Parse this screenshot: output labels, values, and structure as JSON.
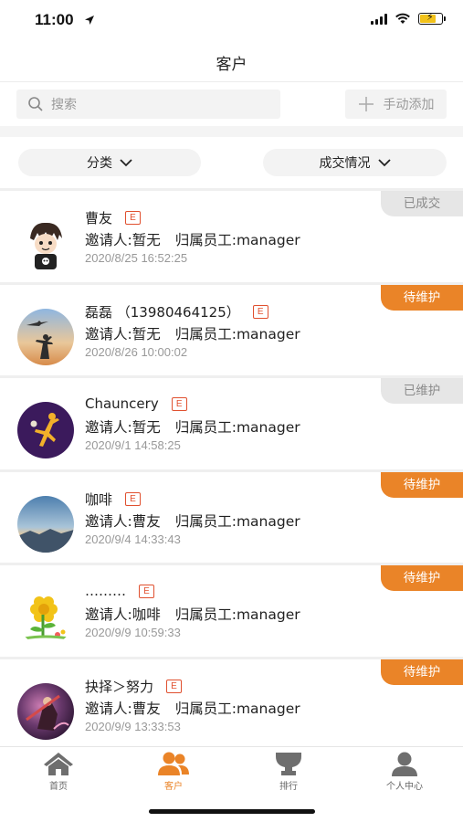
{
  "status_bar": {
    "time": "11:00"
  },
  "nav": {
    "title": "客户"
  },
  "search": {
    "placeholder": "搜索",
    "add_label": "手动添加"
  },
  "filters": {
    "category_label": "分类",
    "deal_label": "成交情况"
  },
  "customers": [
    {
      "name": "曹友",
      "badge": "E",
      "inviter": "邀请人:暂无",
      "staff": "归属员工:manager",
      "time": "2020/8/25 16:52:25",
      "status": "已成交",
      "status_kind": "gray",
      "avatar": "cartoon-boy"
    },
    {
      "name": "磊磊 （13980464125）",
      "badge": "E",
      "inviter": "邀请人:暂无",
      "staff": "归属员工:manager",
      "time": "2020/8/26 10:00:02",
      "status": "待维护",
      "status_kind": "orange",
      "avatar": "sunset-sky"
    },
    {
      "name": "Chauncery",
      "badge": "E",
      "inviter": "邀请人:暂无",
      "staff": "归属员工:manager",
      "time": "2020/9/1 14:58:25",
      "status": "已维护",
      "status_kind": "gray",
      "avatar": "purple-figure"
    },
    {
      "name": "咖啡",
      "badge": "E",
      "inviter": "邀请人:曹友",
      "staff": "归属员工:manager",
      "time": "2020/9/4 14:33:43",
      "status": "待维护",
      "status_kind": "orange",
      "avatar": "blue-landscape"
    },
    {
      "name": "………",
      "badge": "E",
      "inviter": "邀请人:咖啡",
      "staff": "归属员工:manager",
      "time": "2020/9/9 10:59:33",
      "status": "待维护",
      "status_kind": "orange",
      "avatar": "flower"
    },
    {
      "name": "抉择＞努力",
      "badge": "E",
      "inviter": "邀请人:曹友",
      "staff": "归属员工:manager",
      "time": "2020/9/9 13:33:53",
      "status": "待维护",
      "status_kind": "orange",
      "avatar": "warrior-art"
    }
  ],
  "tabs": [
    {
      "label": "首页",
      "icon": "home-icon"
    },
    {
      "label": "客户",
      "icon": "customers-icon",
      "active": true
    },
    {
      "label": "排行",
      "icon": "ranking-icon"
    },
    {
      "label": "个人中心",
      "icon": "profile-icon"
    }
  ],
  "colors": {
    "accent": "#ea8428",
    "badge": "#e0502f",
    "tag_gray": "#e6e6e6"
  }
}
